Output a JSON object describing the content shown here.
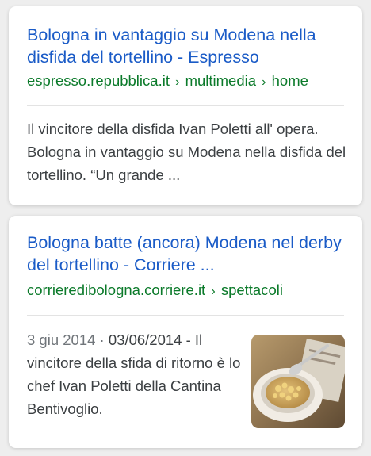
{
  "results": [
    {
      "title": "Bologna in vantaggio su Modena nella disfida del tortellino - Espresso",
      "url_domain": "espresso.repubblica.it",
      "url_path_1": "multimedia",
      "url_path_2": "home",
      "separator": "›",
      "snippet": "Il vincitore della disfida Ivan Poletti all' opera. Bologna in vantaggio su Modena nella disfida del tortellino. “Un grande ..."
    },
    {
      "title": "Bologna batte (ancora) Modena nel derby del tortellino - Corriere ...",
      "url_domain": "corrieredibologna.corriere.it",
      "url_path_1": "spettacoli",
      "separator": "›",
      "date": "3 giu 2014",
      "date_separator": " · ",
      "snippet": "03/06/2014 - Il vincitore della sfida di ritorno è lo chef Ivan Poletti della Cantina Bentivoglio.",
      "thumbnail_icon": "tortellini-bowl-photo"
    }
  ],
  "colors": {
    "title": "#1a5bc7",
    "url": "#0b7a2a",
    "snippet": "#3c4043",
    "date": "#70757a",
    "background": "#eeeeee",
    "card": "#ffffff"
  }
}
